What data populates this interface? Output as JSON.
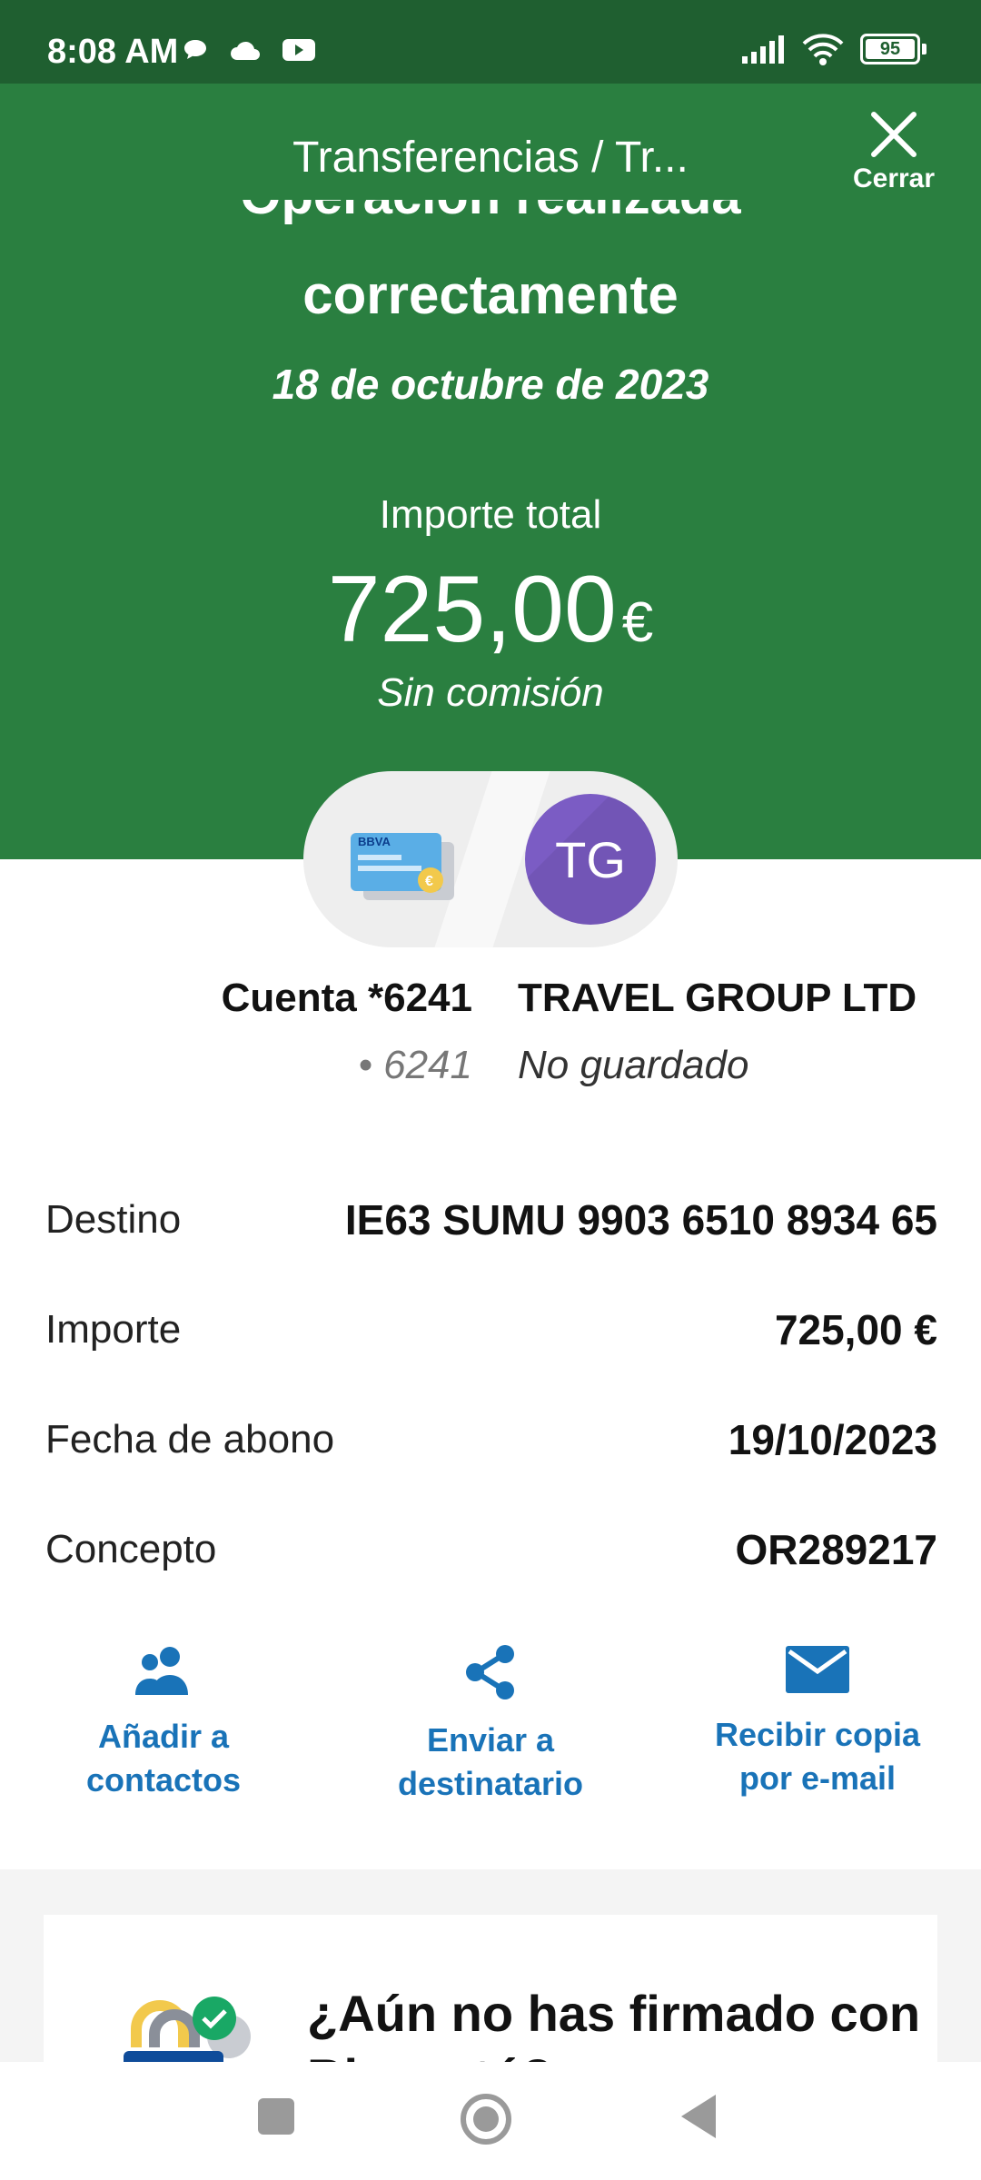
{
  "status_bar": {
    "time": "8:08 AM",
    "battery": "95"
  },
  "header": {
    "title": "Transferencias / Tr...",
    "close_label": "Cerrar",
    "operation_partial": "Operación realizada",
    "operation_title": "correctamente",
    "date": "18 de octubre de 2023"
  },
  "summary": {
    "amount_label": "Importe total",
    "amount": "725,00",
    "currency": "€",
    "fee_text": "Sin comisión"
  },
  "parties": {
    "avatar_initials": "TG",
    "origin_name": "Cuenta *6241",
    "origin_sub": "• 6241",
    "destination_name": "TRAVEL GROUP LTD",
    "destination_sub": "No guardado"
  },
  "details": [
    {
      "label": "Destino",
      "value": "IE63 SUMU 9903 6510 8934 65"
    },
    {
      "label": "Importe",
      "value": "725,00 €"
    },
    {
      "label": "Fecha de abono",
      "value": "19/10/2023"
    },
    {
      "label": "Concepto",
      "value": "OR289217"
    }
  ],
  "actions": [
    {
      "label": "Añadir a\ncontactos",
      "icon": "contacts-icon"
    },
    {
      "label": "Enviar a\ndestinatario",
      "icon": "share-icon"
    },
    {
      "label": "Recibir copia\npor e-mail",
      "icon": "mail-icon"
    }
  ],
  "banner": {
    "title": "¿Aún no has firmado con Bizum tú?"
  },
  "colors": {
    "brand_green": "#2a7f40",
    "status_green": "#1f5f30",
    "link_blue": "#1973b8",
    "avatar_purple": "#7b5cc4"
  }
}
